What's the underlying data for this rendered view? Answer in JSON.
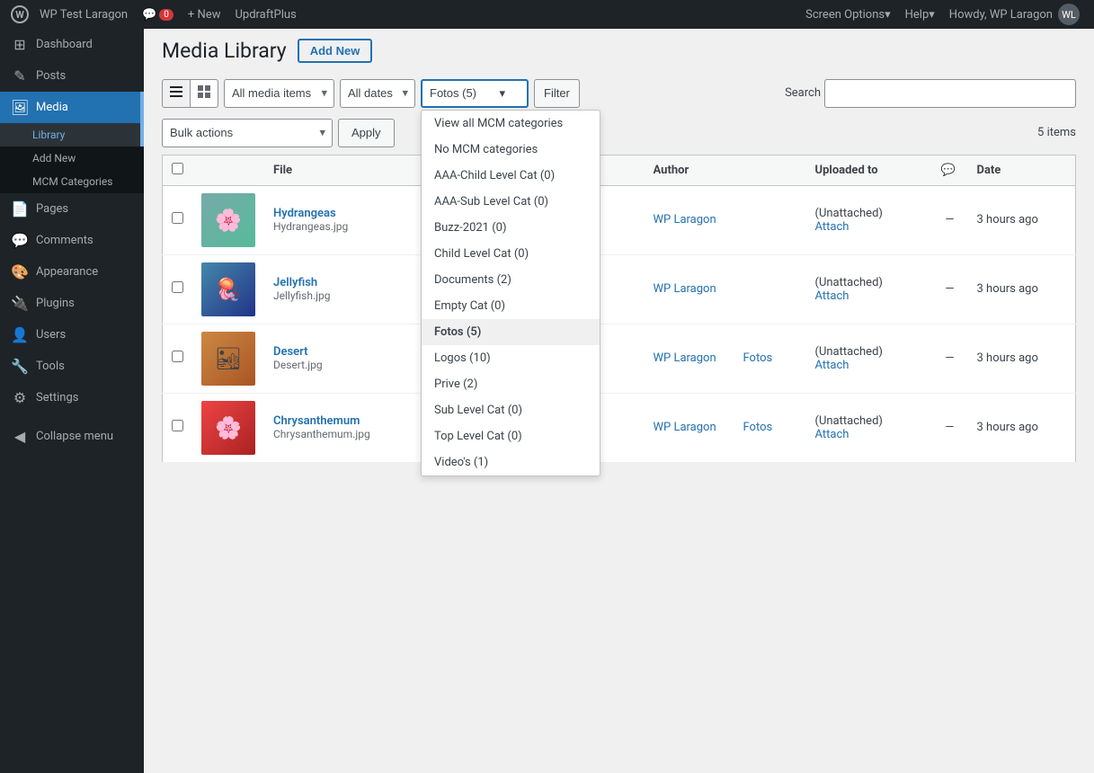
{
  "adminbar": {
    "logo_label": "WordPress",
    "site_name": "WP Test Laragon",
    "comments_label": "0",
    "new_label": "+ New",
    "plugin_label": "UpdraftPlus",
    "howdy": "Howdy, WP Laragon",
    "screen_options_label": "Screen Options",
    "help_label": "Help"
  },
  "sidebar": {
    "items": [
      {
        "id": "dashboard",
        "label": "Dashboard",
        "icon": "⊞"
      },
      {
        "id": "posts",
        "label": "Posts",
        "icon": "✎"
      },
      {
        "id": "media",
        "label": "Media",
        "icon": "🖼",
        "active": true
      },
      {
        "id": "pages",
        "label": "Pages",
        "icon": "📄"
      },
      {
        "id": "comments",
        "label": "Comments",
        "icon": "💬"
      },
      {
        "id": "appearance",
        "label": "Appearance",
        "icon": "🎨"
      },
      {
        "id": "plugins",
        "label": "Plugins",
        "icon": "🔌"
      },
      {
        "id": "users",
        "label": "Users",
        "icon": "👤"
      },
      {
        "id": "tools",
        "label": "Tools",
        "icon": "🔧"
      },
      {
        "id": "settings",
        "label": "Settings",
        "icon": "⚙"
      }
    ],
    "media_submenu": [
      {
        "id": "library",
        "label": "Library",
        "active": true
      },
      {
        "id": "add-new",
        "label": "Add New"
      },
      {
        "id": "mcm-categories",
        "label": "MCM Categories"
      }
    ],
    "collapse_label": "Collapse menu"
  },
  "page": {
    "title": "Media Library",
    "add_new_label": "Add New"
  },
  "filters": {
    "media_items_label": "All media items",
    "dates_label": "All dates",
    "category_label": "Fotos  (5)",
    "filter_btn_label": "Filter",
    "search_label": "Search"
  },
  "bulk_actions": {
    "select_label": "Bulk actions",
    "apply_label": "Apply",
    "items_count": "5 items"
  },
  "table": {
    "columns": [
      {
        "id": "file",
        "label": "File"
      },
      {
        "id": "author",
        "label": "Author"
      },
      {
        "id": "uploaded",
        "label": "Uploaded to"
      },
      {
        "id": "comment",
        "label": "💬"
      },
      {
        "id": "date",
        "label": "Date"
      }
    ],
    "rows": [
      {
        "id": 1,
        "title": "Hydrangeas",
        "filename": "Hydrangeas.jpg",
        "author": "WP Laragon",
        "category": "",
        "uploaded_to": "(Unattached)",
        "attach_label": "Attach",
        "comment_count": "—",
        "date": "3 hours ago",
        "thumb_class": "thumb-hydrangea",
        "thumb_text": "🌸"
      },
      {
        "id": 2,
        "title": "Jellyfish",
        "filename": "Jellyfish.jpg",
        "author": "WP Laragon",
        "category": "",
        "uploaded_to": "(Unattached)",
        "attach_label": "Attach",
        "comment_count": "—",
        "date": "3 hours ago",
        "thumb_class": "thumb-jellyfish",
        "thumb_text": "🪼"
      },
      {
        "id": 3,
        "title": "Desert",
        "filename": "Desert.jpg",
        "author": "WP Laragon",
        "category": "Fotos",
        "uploaded_to": "(Unattached)",
        "attach_label": "Attach",
        "comment_count": "—",
        "date": "3 hours ago",
        "thumb_class": "thumb-desert",
        "thumb_text": "🏜"
      },
      {
        "id": 4,
        "title": "Chrysanthemum",
        "filename": "Chrysanthemum.jpg",
        "author": "WP Laragon",
        "category": "Fotos",
        "uploaded_to": "(Unattached)",
        "attach_label": "Attach",
        "comment_count": "—",
        "date": "3 hours ago",
        "thumb_class": "thumb-chrysanthemum",
        "thumb_text": "🌸"
      }
    ]
  },
  "category_dropdown": {
    "options": [
      {
        "id": "view-all",
        "label": "View all MCM categories"
      },
      {
        "id": "no-mcm",
        "label": "No MCM categories"
      },
      {
        "id": "aaa-child",
        "label": "AAA-Child Level Cat  (0)"
      },
      {
        "id": "aaa-sub",
        "label": "AAA-Sub Level Cat  (0)"
      },
      {
        "id": "buzz-2021",
        "label": "Buzz-2021  (0)"
      },
      {
        "id": "child-level",
        "label": "Child Level Cat  (0)"
      },
      {
        "id": "documents",
        "label": "Documents  (2)"
      },
      {
        "id": "empty-cat",
        "label": "Empty Cat  (0)"
      },
      {
        "id": "fotos",
        "label": "Fotos  (5)",
        "selected": true
      },
      {
        "id": "logos",
        "label": "Logos  (10)"
      },
      {
        "id": "prive",
        "label": "Prive  (2)"
      },
      {
        "id": "sub-level",
        "label": "Sub Level Cat  (0)"
      },
      {
        "id": "top-level",
        "label": "Top Level Cat  (0)"
      },
      {
        "id": "videos",
        "label": "Video's  (1)"
      }
    ]
  }
}
